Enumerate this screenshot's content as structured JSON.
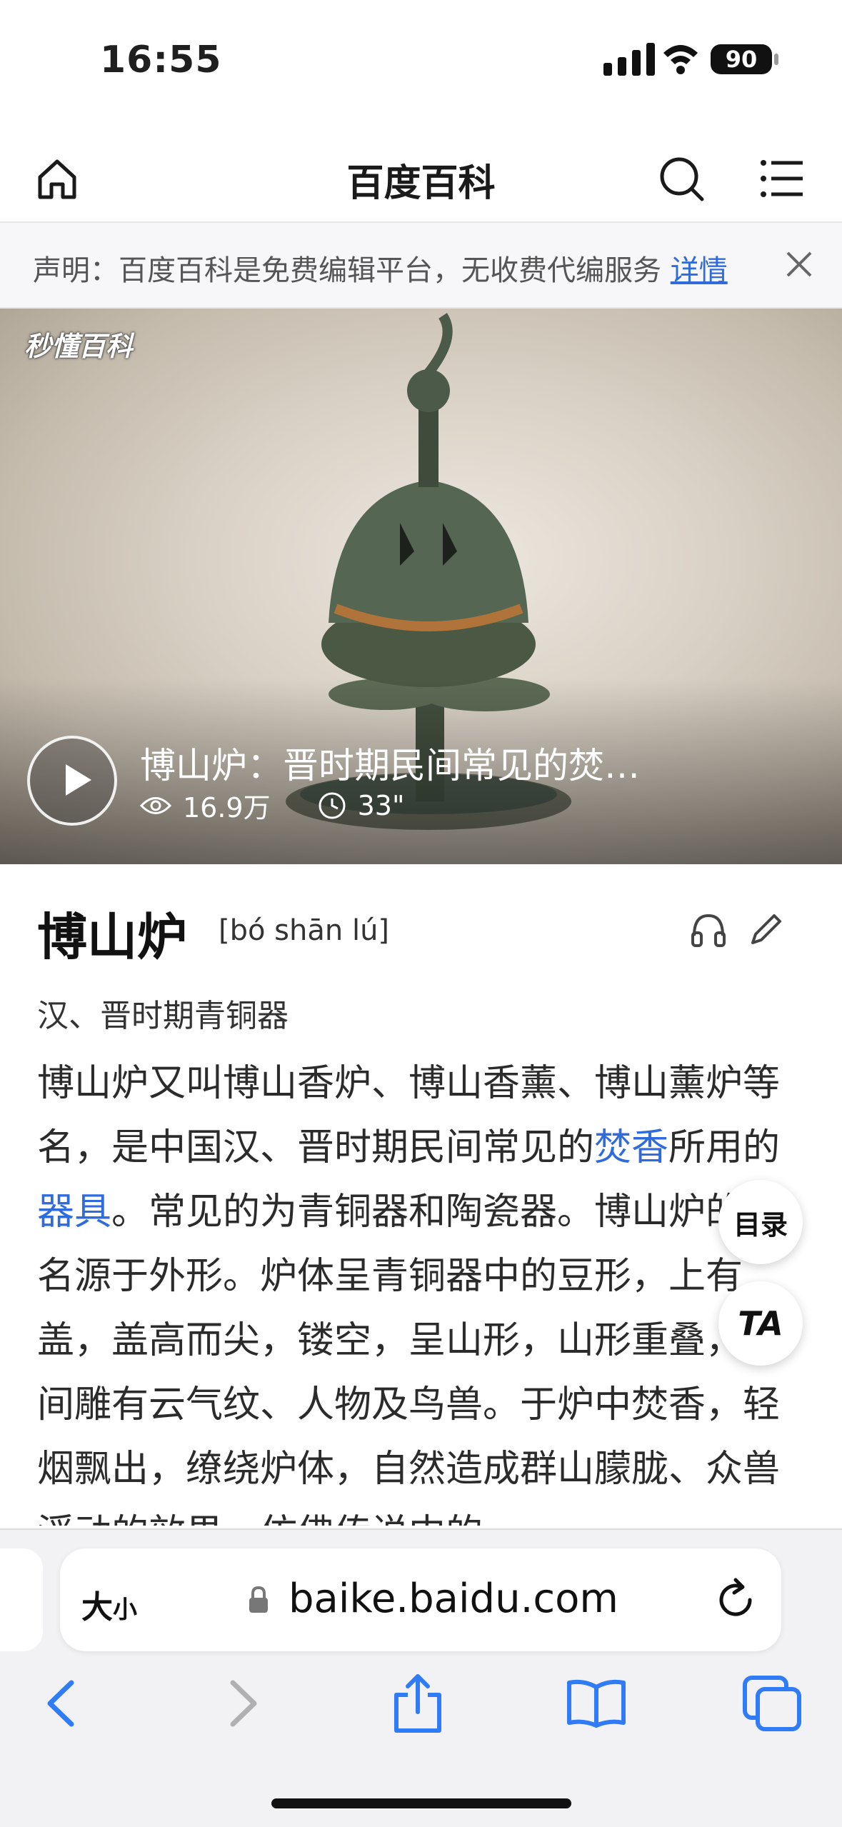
{
  "status": {
    "time": "16:55",
    "battery": "90"
  },
  "header": {
    "title": "百度百科"
  },
  "notice": {
    "text": "声明：百度百科是免费编辑平台，无收费代编服务 ",
    "link": "详情"
  },
  "hero": {
    "watermark": "秒懂百科",
    "video_title": "博山炉：晋时期民间常见的焚…",
    "views": "16.9万",
    "duration": "33\""
  },
  "entry": {
    "title": "博山炉",
    "pinyin": "[bó shān lú]",
    "subtitle": "汉、晋时期青铜器",
    "para": {
      "t1": "博山炉又叫博山香炉、博山香薰、博山薰炉等名，是中国汉、晋时期民间常见的",
      "link1": "焚香",
      "t2": "所用的",
      "link2": "器具",
      "t3": "。常见的为青铜器和陶瓷器。博山炉的得名源于外形。炉体呈青铜器中的豆形，上有盖，盖高而尖，镂空，呈山形，山形重叠，其间雕有云气纹、人物及鸟兽。于炉中焚香，轻烟飘出，缭绕炉体，自然造成群山朦胧、众兽浮动的效果，仿佛传说中的"
    }
  },
  "floating": {
    "toc": "目录",
    "ta": "TA"
  },
  "browser": {
    "size_big": "大",
    "size_small": "小",
    "url": "baike.baidu.com"
  },
  "icons": [
    "home-icon",
    "search-icon",
    "menu-icon",
    "close-icon",
    "play-icon",
    "eye-icon",
    "clock-icon",
    "headphones-icon",
    "edit-icon",
    "lock-icon",
    "reload-icon",
    "back-icon",
    "forward-icon",
    "share-icon",
    "bookmarks-icon",
    "tabs-icon"
  ]
}
